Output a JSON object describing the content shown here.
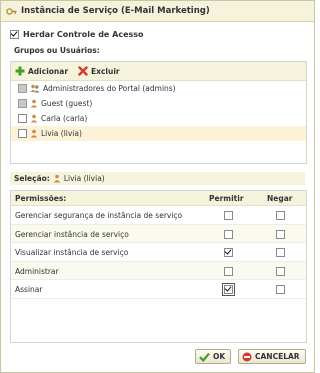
{
  "dialog": {
    "title": "Instância de Serviço (E-Mail Marketing)"
  },
  "inherit": {
    "label": "Herdar Controle de Acesso",
    "checked": true
  },
  "groups": {
    "title": "Grupos ou Usuários:",
    "add_label": "Adicionar",
    "remove_label": "Excluir",
    "items": [
      {
        "label": "Administradores do Portal (admins)",
        "icon": "group-icon"
      },
      {
        "label": "Guest (guest)",
        "icon": "user-icon"
      },
      {
        "label": "Carla (carla)",
        "icon": "user-icon"
      },
      {
        "label": "Livia (livia)",
        "icon": "user-icon"
      }
    ]
  },
  "selection": {
    "label": "Seleção:",
    "value": "Livia (livia)"
  },
  "permissions": {
    "header_name": "Permissões:",
    "header_allow": "Permitir",
    "header_deny": "Negar",
    "rows": [
      {
        "label": "Gerenciar segurança de instância de serviço",
        "allow": false,
        "deny": false
      },
      {
        "label": "Gerenciar instância de serviço",
        "allow": false,
        "deny": false
      },
      {
        "label": "Visualizar instância de serviço",
        "allow": true,
        "deny": false
      },
      {
        "label": "Administrar",
        "allow": false,
        "deny": false
      },
      {
        "label": "Assinar",
        "allow": true,
        "deny": false
      }
    ]
  },
  "buttons": {
    "ok_label": "OK",
    "cancel_label": "CANCELAR"
  },
  "colors": {
    "header_bg": "#f6f3dc",
    "selected_row": "#fbf2d8",
    "ok_green": "#4a9a2a",
    "cancel_red": "#d23a2a"
  }
}
